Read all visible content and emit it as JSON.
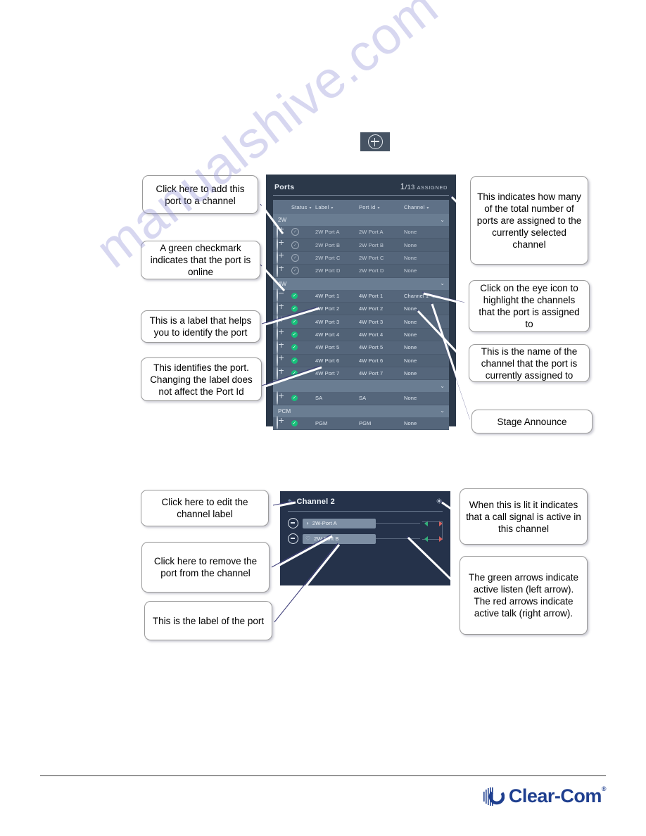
{
  "watermark": "manualshive.com",
  "top_button": {
    "name": "add-button",
    "icon": "plus-circle-icon"
  },
  "ports_panel": {
    "title": "Ports",
    "count_numerator": "1",
    "count_denominator": "/13",
    "count_suffix": "ASSIGNED",
    "columns": [
      "Status",
      "Label",
      "Port Id",
      "Channel"
    ],
    "groups": [
      {
        "name": "2W",
        "rows": [
          {
            "action": "plus",
            "status": "off",
            "label": "2W Port A",
            "port_id": "2W Port A",
            "channel": "None",
            "eye": false
          },
          {
            "action": "plus",
            "status": "off",
            "label": "2W Port B",
            "port_id": "2W Port B",
            "channel": "None",
            "eye": false
          },
          {
            "action": "plus",
            "status": "off",
            "label": "2W Port C",
            "port_id": "2W Port C",
            "channel": "None",
            "eye": false
          },
          {
            "action": "plus",
            "status": "off",
            "label": "2W Port D",
            "port_id": "2W Port D",
            "channel": "None",
            "eye": false
          }
        ]
      },
      {
        "name": "4W",
        "rows": [
          {
            "action": "minus",
            "status": "on",
            "label": "4W Port 1",
            "port_id": "4W Port 1",
            "channel": "Channel 1",
            "eye": true
          },
          {
            "action": "plus",
            "status": "on",
            "label": "4W Port 2",
            "port_id": "4W Port 2",
            "channel": "None",
            "eye": false
          },
          {
            "action": "plus",
            "status": "on",
            "label": "4W Port 3",
            "port_id": "4W Port 3",
            "channel": "None",
            "eye": false
          },
          {
            "action": "plus",
            "status": "on",
            "label": "4W Port 4",
            "port_id": "4W Port 4",
            "channel": "None",
            "eye": false
          },
          {
            "action": "plus",
            "status": "on",
            "label": "4W Port 5",
            "port_id": "4W Port 5",
            "channel": "None",
            "eye": false
          },
          {
            "action": "plus",
            "status": "on",
            "label": "4W Port 6",
            "port_id": "4W Port 6",
            "channel": "None",
            "eye": false
          },
          {
            "action": "plus",
            "status": "on",
            "label": "4W Port 7",
            "port_id": "4W Port 7",
            "channel": "None",
            "eye": false
          }
        ]
      },
      {
        "name": "",
        "rows": [
          {
            "action": "plus",
            "status": "on",
            "label": "SA",
            "port_id": "SA",
            "channel": "None",
            "eye": false
          }
        ]
      },
      {
        "name": "PCM",
        "rows": [
          {
            "action": "plus",
            "status": "on",
            "label": "PGM",
            "port_id": "PGM",
            "channel": "None",
            "eye": false
          }
        ]
      }
    ]
  },
  "channel_panel": {
    "title": "Channel 2",
    "edit_icon": "pencil-icon",
    "call_icon": "call-signal-icon",
    "rows": [
      {
        "label": "2W-Port A",
        "icon": "speaker-icon",
        "listen": true,
        "talk": true
      },
      {
        "label": "2W-Port B",
        "icon": "headset-icon",
        "listen": true,
        "talk": true
      }
    ]
  },
  "callouts": {
    "add_port": "Click here to add this port to a channel",
    "green_check": "A green checkmark indicates that the port is online",
    "label_help": "This is a label that helps you to identify the port",
    "port_id": "This identifies the port. Changing the label does not affect the Port Id",
    "assigned_count": "This indicates how many of the total number of ports are assigned to the currently selected channel",
    "eye_icon": "Click on the eye icon to highlight the channels that the port is assigned to",
    "channel_name": "This is the name of the channel that the port is currently assigned to",
    "stage_announce": "Stage Announce",
    "edit_channel": "Click here to edit the channel label",
    "remove_port": "Click here to remove the port from the channel",
    "port_label": "This is the label of the port",
    "call_lit": "When this is lit it indicates that a call signal is active in this channel",
    "arrows": "The green arrows indicate active listen (left arrow). The red arrows indicate active talk (right arrow)."
  },
  "footer": {
    "brand": "Clear-Com",
    "registered": "®"
  },
  "colors": {
    "panel_bg": "#2b3849",
    "row_bg": "#55667b",
    "group_bg": "#6a7d92",
    "status_on": "#17c07a",
    "listen_arrow": "#34b07a",
    "talk_arrow": "#d4625f",
    "brand_blue": "#1f3f8f"
  }
}
